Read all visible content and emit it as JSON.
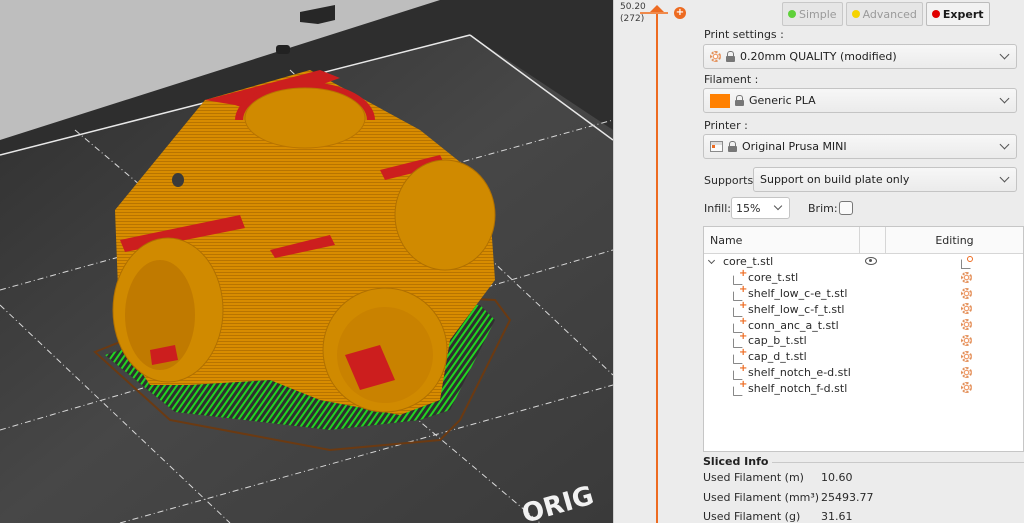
{
  "layer_slider": {
    "height_value": "50.20",
    "layer_value": "(272)",
    "accent": "#ed6b21"
  },
  "mode_buttons": [
    {
      "label": "Simple",
      "color": "#5fd13a",
      "active": false
    },
    {
      "label": "Advanced",
      "color": "#f5d300",
      "active": false
    },
    {
      "label": "Expert",
      "color": "#e00000",
      "active": true
    }
  ],
  "print_settings": {
    "label": "Print settings :",
    "value": "0.20mm QUALITY (modified)",
    "icon": "gear-icon"
  },
  "filament": {
    "label": "Filament :",
    "value": "Generic PLA",
    "color": "#ff8000"
  },
  "printer": {
    "label": "Printer :",
    "value": "Original Prusa MINI",
    "icon": "printer-icon"
  },
  "supports": {
    "label": "Supports:",
    "value": "Support on build plate only"
  },
  "infill": {
    "label": "Infill:",
    "value": "15%"
  },
  "brim": {
    "label": "Brim:",
    "checked": false
  },
  "object_list": {
    "columns": {
      "name": "Name",
      "visibility": "",
      "editing": "Editing"
    },
    "object": {
      "name": "core_t.stl",
      "expanded": true
    },
    "parts": [
      {
        "name": "core_t.stl"
      },
      {
        "name": "shelf_low_c-e_t.stl"
      },
      {
        "name": "shelf_low_c-f_t.stl"
      },
      {
        "name": "conn_anc_a_t.stl"
      },
      {
        "name": "cap_b_t.stl"
      },
      {
        "name": "cap_d_t.stl"
      },
      {
        "name": "shelf_notch_e-d.stl"
      },
      {
        "name": "shelf_notch_f-d.stl"
      }
    ]
  },
  "sliced_info": {
    "title": "Sliced Info",
    "rows": [
      {
        "label": "Used Filament (m)",
        "value": "10.60"
      },
      {
        "label": "Used Filament (mm³)",
        "value": "25493.77"
      },
      {
        "label": "Used Filament (g)",
        "value": "31.61"
      }
    ]
  },
  "viewport": {
    "bed_label": "ORIG",
    "colors": {
      "perimeter": "#d88c00",
      "top_solid": "#cc1e1e",
      "support": "#1fce1f",
      "skirt": "#6b3a12",
      "bed": "#3c3c3c",
      "background": "#bdbdbd"
    }
  }
}
